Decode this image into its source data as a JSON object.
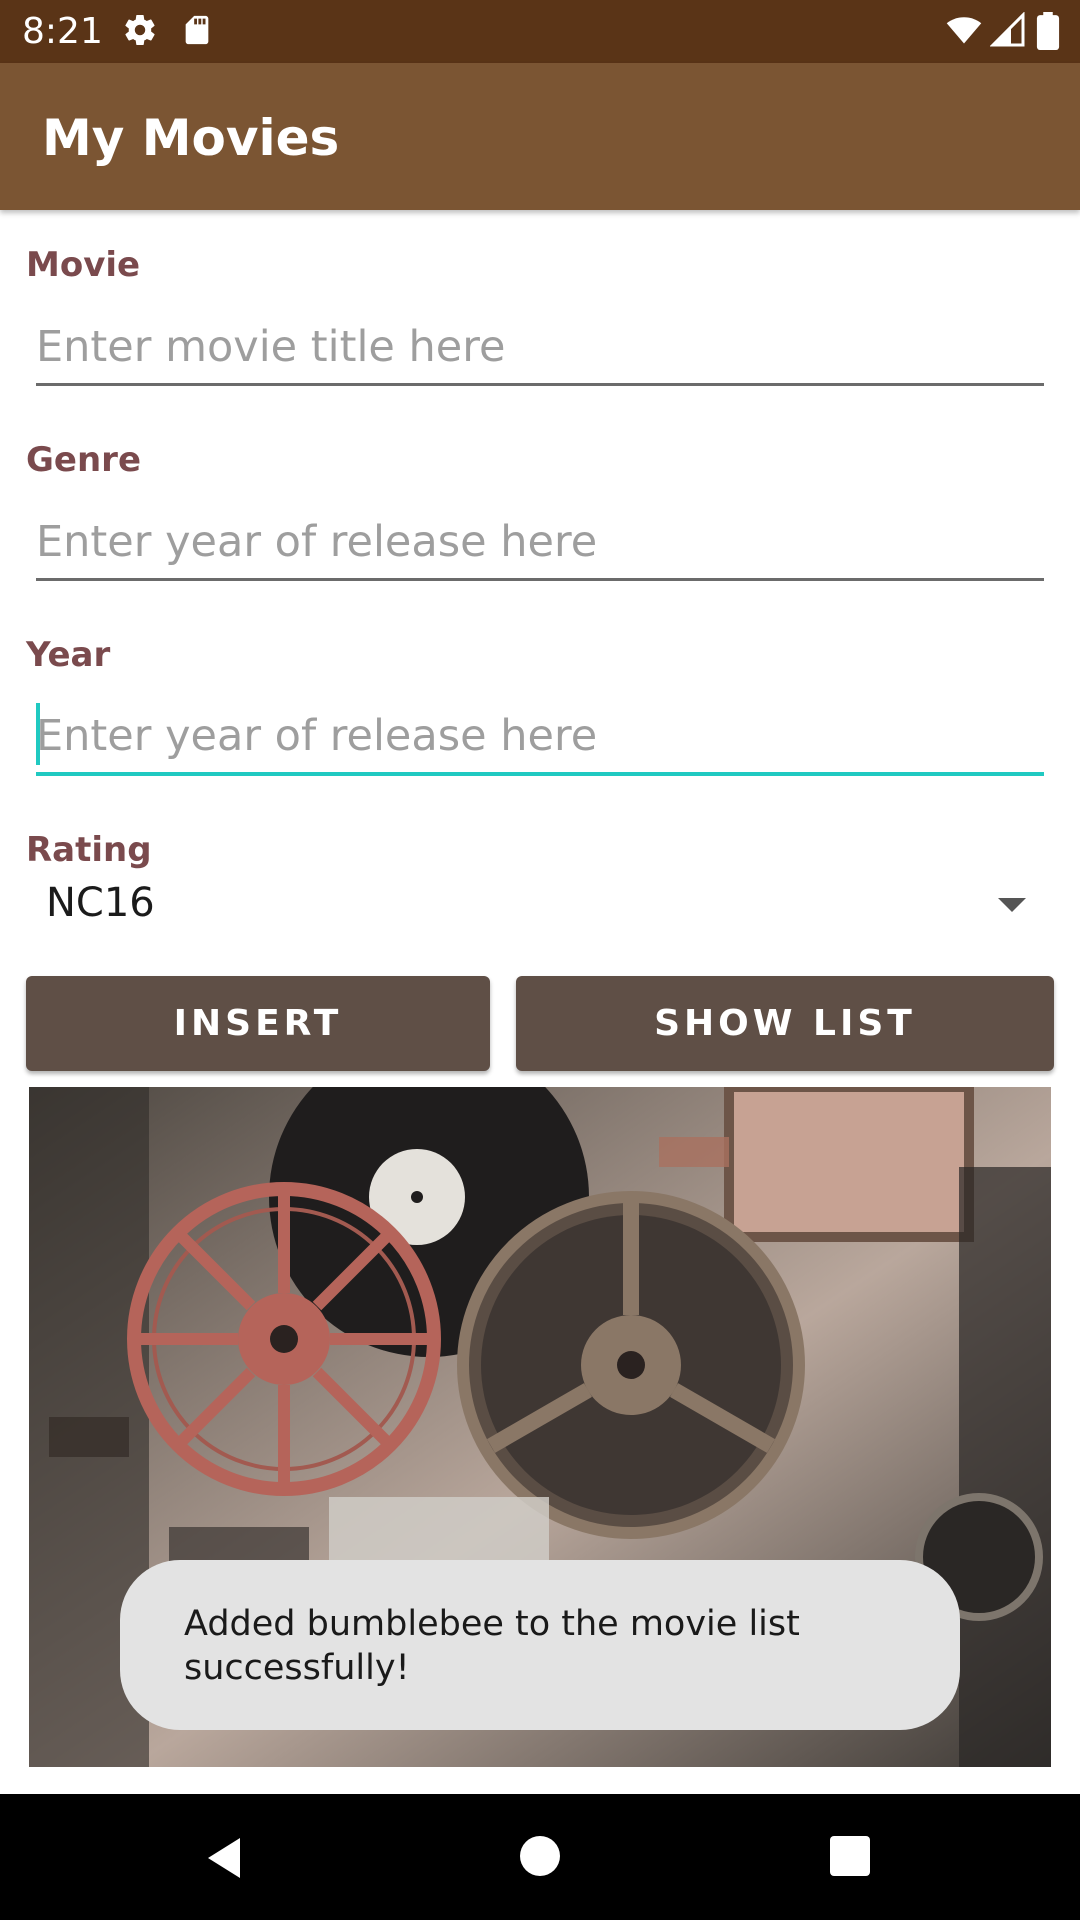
{
  "status_bar": {
    "time": "8:21",
    "icons": [
      "gear-icon",
      "sd-card-icon",
      "wifi-icon",
      "signal-icon",
      "battery-icon"
    ]
  },
  "app_bar": {
    "title": "My Movies",
    "color": "#7b5533"
  },
  "form": {
    "movie": {
      "label": "Movie",
      "placeholder": "Enter movie title here"
    },
    "genre": {
      "label": "Genre",
      "placeholder": "Enter year of release here"
    },
    "year": {
      "label": "Year",
      "placeholder": "Enter year of release here",
      "focused": true
    },
    "rating": {
      "label": "Rating",
      "selected": "NC16"
    }
  },
  "buttons": {
    "insert": "INSERT",
    "show_list": "SHOW LIST"
  },
  "image": {
    "description_icon": "film-reels-photo"
  },
  "toast": {
    "message": "Added bumblebee to the movie list successfully!"
  },
  "nav_bar": {
    "icons": [
      "back-icon",
      "home-icon",
      "recents-icon"
    ]
  },
  "colors": {
    "accent": "#20c9c1",
    "label": "#7a4a4d",
    "button": "#5f4f46",
    "status_bar": "#5a3417"
  }
}
